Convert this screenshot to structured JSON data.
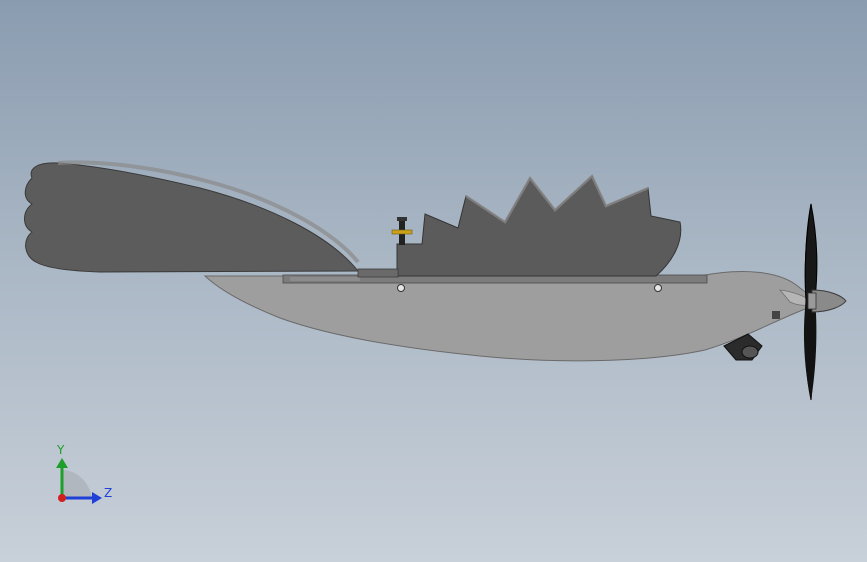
{
  "triad": {
    "y_label": "Y",
    "z_label": "Z",
    "y_color": "#1e9e2a",
    "z_color": "#1f3fd6",
    "x_color": "#d11f1f"
  },
  "colors": {
    "background_top": "#8a9cb0",
    "background_bottom": "#c8d0d9",
    "body": "#9c9c9c",
    "plate": "#5e5e5e",
    "propeller": "#151515"
  },
  "icons": {
    "model": "ornithopter-bird-model",
    "view_triad": "axis-triad-icon"
  }
}
